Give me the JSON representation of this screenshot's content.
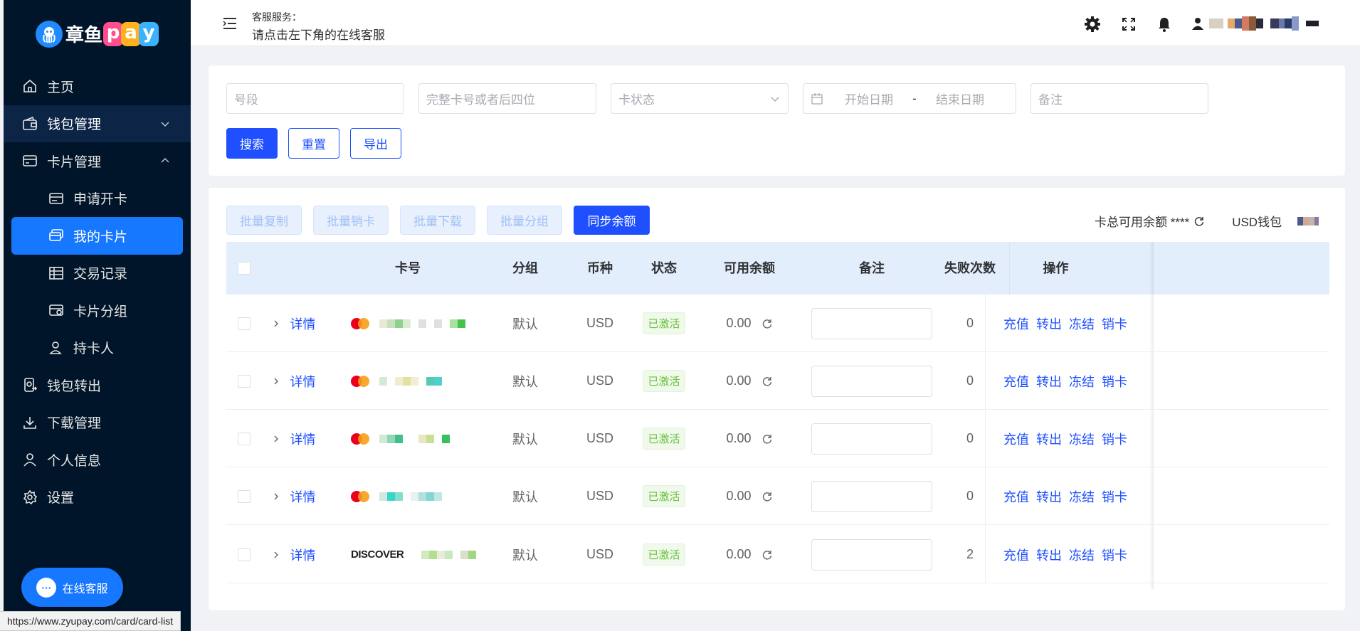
{
  "sidebar": {
    "logo_text": "章鱼",
    "logo_pay": [
      "p",
      "a",
      "y"
    ],
    "logo_pay_colors": [
      "#ff4d8d",
      "#ffb21f",
      "#3bb2ff"
    ],
    "menu": [
      {
        "label": "主页",
        "icon": "home-icon"
      },
      {
        "label": "钱包管理",
        "icon": "wallet-icon"
      },
      {
        "label": "卡片管理",
        "icon": "card-icon"
      }
    ],
    "card_submenu": [
      {
        "label": "申请开卡",
        "icon": "apply-card-icon"
      },
      {
        "label": "我的卡片",
        "icon": "my-cards-icon"
      },
      {
        "label": "交易记录",
        "icon": "table-icon"
      },
      {
        "label": "卡片分组",
        "icon": "card-group-icon"
      },
      {
        "label": "持卡人",
        "icon": "user-icon"
      }
    ],
    "menu_bottom": [
      {
        "label": "钱包转出",
        "icon": "wallet-out-icon"
      },
      {
        "label": "下载管理",
        "icon": "download-icon"
      },
      {
        "label": "个人信息",
        "icon": "profile-icon"
      },
      {
        "label": "设置",
        "icon": "settings-icon"
      }
    ],
    "chat_label": "在线客服"
  },
  "status_url": "https://www.zyupay.com/card/card-list",
  "header": {
    "cs_title": "客服服务：",
    "cs_text": "请点击左下角的在线客服"
  },
  "filters": {
    "segment_placeholder": "号段",
    "card_number_placeholder": "完整卡号或者后四位",
    "status_placeholder": "卡状态",
    "start_date_placeholder": "开始日期",
    "date_separator": "-",
    "end_date_placeholder": "结束日期",
    "remark_placeholder": "备注",
    "search_label": "搜索",
    "reset_label": "重置",
    "export_label": "导出"
  },
  "toolbar": {
    "batch_copy": "批量复制",
    "batch_cancel": "批量销卡",
    "batch_download": "批量下载",
    "batch_group": "批量分组",
    "sync_balance": "同步余额",
    "total_balance_label": "卡总可用余额 ****",
    "wallet_label": "USD钱包"
  },
  "table": {
    "headers": {
      "card_number": "卡号",
      "group": "分组",
      "currency": "币种",
      "status": "状态",
      "available_balance": "可用余额",
      "remark": "备注",
      "fail_count": "失败次数",
      "actions": "操作"
    },
    "details_label": "详情",
    "actions": [
      "充值",
      "转出",
      "冻结",
      "销卡"
    ],
    "rows": [
      {
        "brand": "mastercard",
        "group": "默认",
        "currency": "USD",
        "status": "已激活",
        "balance": "0.00",
        "fail_count": "0"
      },
      {
        "brand": "mastercard",
        "group": "默认",
        "currency": "USD",
        "status": "已激活",
        "balance": "0.00",
        "fail_count": "0"
      },
      {
        "brand": "mastercard",
        "group": "默认",
        "currency": "USD",
        "status": "已激活",
        "balance": "0.00",
        "fail_count": "0"
      },
      {
        "brand": "mastercard",
        "group": "默认",
        "currency": "USD",
        "status": "已激活",
        "balance": "0.00",
        "fail_count": "0"
      },
      {
        "brand": "discover",
        "brand_label": "DISCOVER",
        "group": "默认",
        "currency": "USD",
        "status": "已激活",
        "balance": "0.00",
        "fail_count": "2"
      }
    ]
  }
}
